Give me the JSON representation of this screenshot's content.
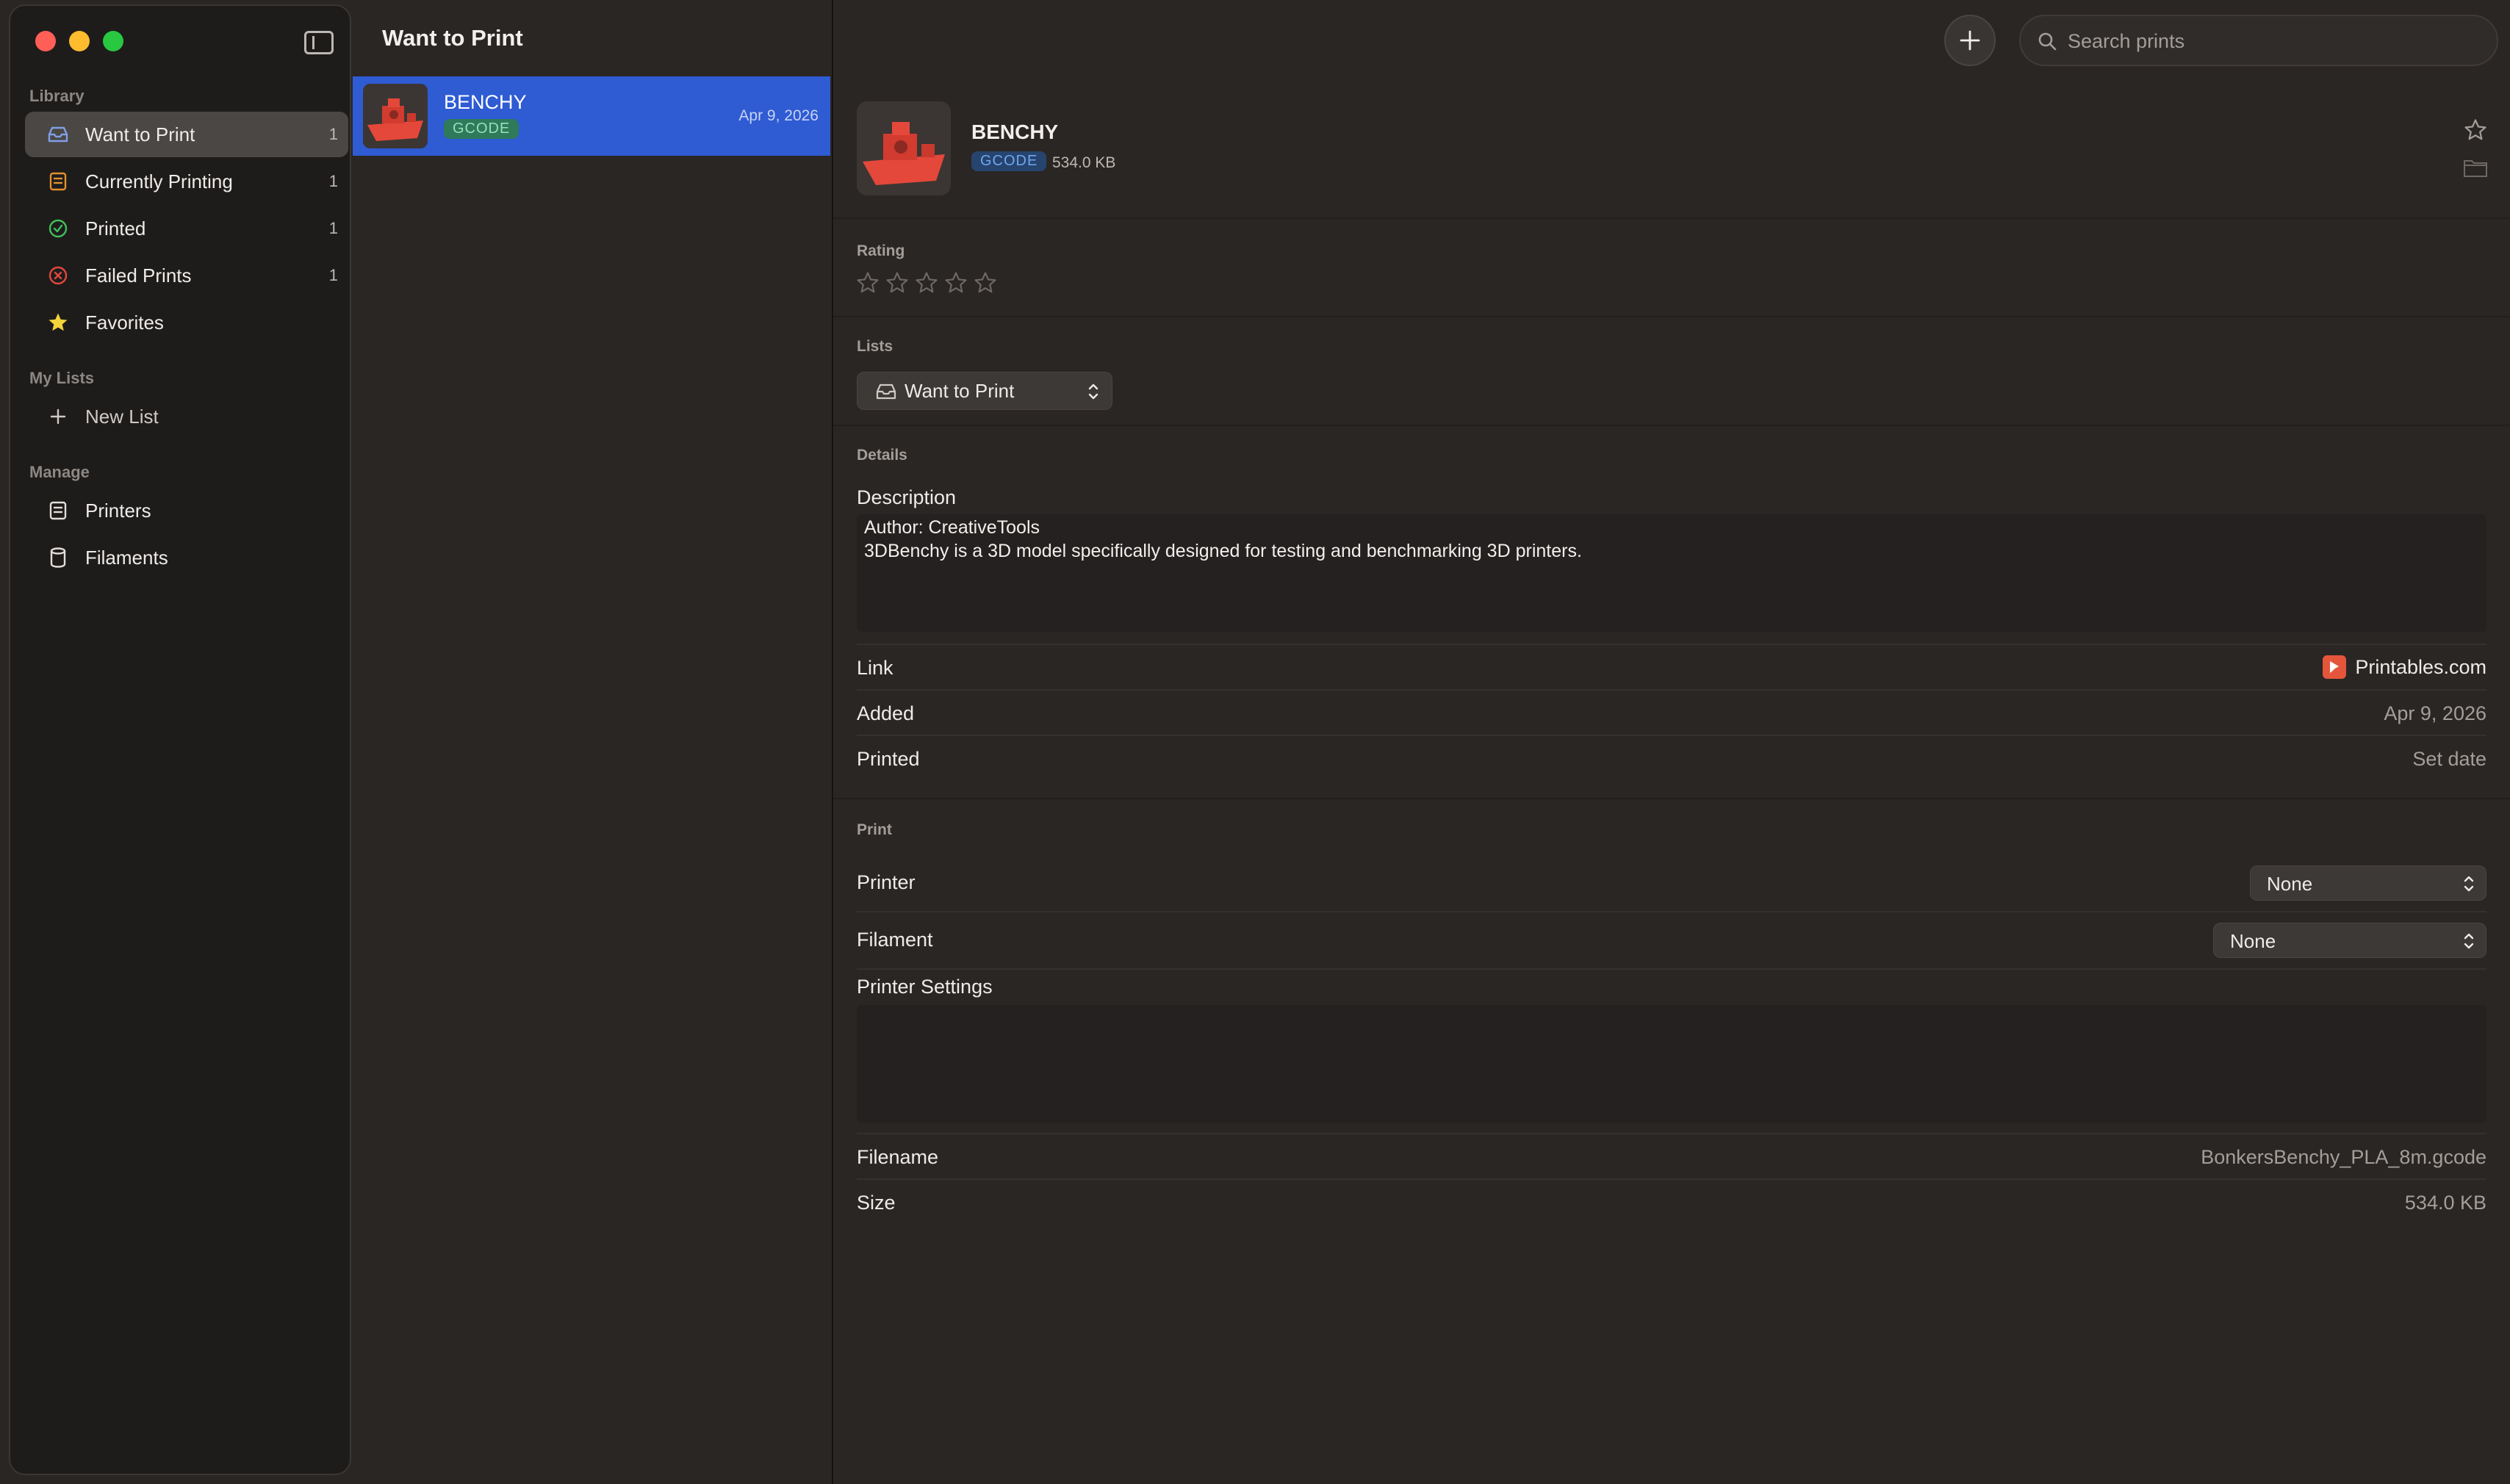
{
  "sidebar": {
    "library_label": "Library",
    "items": [
      {
        "label": "Want to Print",
        "count": "1",
        "icon": "tray-icon"
      },
      {
        "label": "Currently Printing",
        "count": "1",
        "icon": "printer-icon"
      },
      {
        "label": "Printed",
        "count": "1",
        "icon": "checkmark-circle-icon"
      },
      {
        "label": "Failed Prints",
        "count": "1",
        "icon": "x-circle-icon"
      },
      {
        "label": "Favorites",
        "count": "",
        "icon": "star-icon"
      }
    ],
    "my_lists_label": "My Lists",
    "new_list_label": "New List",
    "manage_label": "Manage",
    "manage_items": [
      {
        "label": "Printers",
        "icon": "printer-icon"
      },
      {
        "label": "Filaments",
        "icon": "cylinder-icon"
      }
    ]
  },
  "list": {
    "title": "Want to Print",
    "rows": [
      {
        "name": "BENCHY",
        "badge": "GCODE",
        "date": "Apr 9, 2026"
      }
    ]
  },
  "toolbar": {
    "add_icon": "plus-icon",
    "search_placeholder": "Search prints"
  },
  "detail": {
    "name": "BENCHY",
    "badge": "GCODE",
    "size_short": "534.0 KB",
    "rating_label": "Rating",
    "rating_value": 0,
    "rating_max": 5,
    "lists_label": "Lists",
    "list_selected": "Want to Print",
    "details_label": "Details",
    "description_label": "Description",
    "description_lines": [
      "Author: CreativeTools",
      "3DBenchy is a 3D model specifically designed for testing and benchmarking 3D printers."
    ],
    "link_label": "Link",
    "link_value": "Printables.com",
    "added_label": "Added",
    "added_value": "Apr 9, 2026",
    "printed_label": "Printed",
    "printed_value": "Set date",
    "print_label": "Print",
    "printer_label": "Printer",
    "printer_value": "None",
    "filament_label": "Filament",
    "filament_value": "None",
    "printer_settings_label": "Printer Settings",
    "printer_settings_value": "",
    "filename_label": "Filename",
    "filename_value": "BonkersBenchy_PLA_8m.gcode",
    "size_label": "Size",
    "size_value": "534.0 KB"
  },
  "colors": {
    "accent": "#2f5bd3",
    "close": "#ff5f57",
    "minimize": "#febc2e",
    "maximize": "#28c840",
    "favorites_star": "#f5d33a",
    "printed_green": "#3fbf5a",
    "failed_red": "#e0473e",
    "printing_orange": "#e2902e",
    "benchy_red": "#e4483a"
  }
}
